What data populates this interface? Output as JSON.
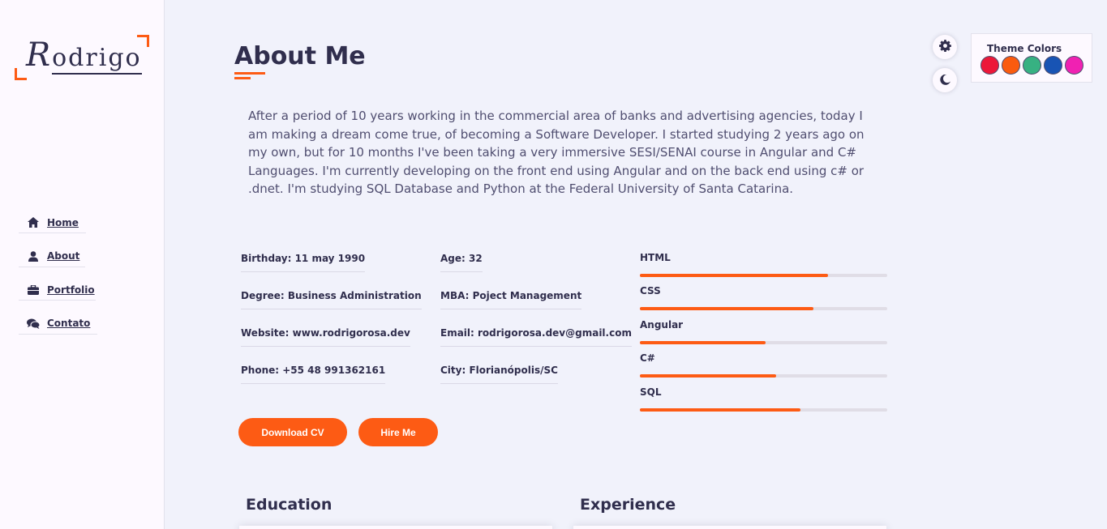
{
  "sidebar": {
    "logo": {
      "first": "R",
      "rest": "odrigo"
    },
    "nav": [
      {
        "label": "Home",
        "icon": "home-icon"
      },
      {
        "label": "About",
        "icon": "user-icon"
      },
      {
        "label": "Portfolio",
        "icon": "briefcase-icon"
      },
      {
        "label": "Contato",
        "icon": "comments-icon"
      }
    ]
  },
  "main": {
    "title": "About Me",
    "about_text": "After a period of 10 years working in the commercial area of banks and advertising agencies, today I am making a dream come true, of becoming a Software Developer. I started studying 2 years ago on my own, but for 10 months I've been taking a very immersive SESI/SENAI course in Angular and C# Languages. I'm currently developing on the front end using Angular and on the back end using c# or .dnet. I'm studying SQL Database and Python at the Federal University of Santa Catarina.",
    "info": {
      "birthday": "Birthday: 11 may 1990",
      "age": "Age: 32",
      "degree": "Degree: Business Administration",
      "mba": "MBA: Poject Management",
      "website": "Website: www.rodrigorosa.dev",
      "email": "Email: rodrigorosa.dev@gmail.com",
      "phone": "Phone: +55 48 991362161",
      "city": "City: Florianópolis/SC"
    },
    "skills": [
      {
        "name": "HTML",
        "level": 0.76
      },
      {
        "name": "CSS",
        "level": 0.7
      },
      {
        "name": "Angular",
        "level": 0.508
      },
      {
        "name": "C#",
        "level": 0.551
      },
      {
        "name": "SQL",
        "level": 0.649
      }
    ],
    "buttons": {
      "download": "Download CV",
      "hire": "Hire Me"
    },
    "sections": {
      "education": "Education",
      "experience": "Experience"
    }
  },
  "style_switcher": {
    "settings_icon": "gear-icon",
    "dark_mode_icon": "moon-icon",
    "title": "Theme Colors",
    "colors": [
      "#ec1839",
      "#fa5b0f",
      "#37b182",
      "#1854b4",
      "#f021b2"
    ]
  },
  "accent_color": "#fd5b14"
}
